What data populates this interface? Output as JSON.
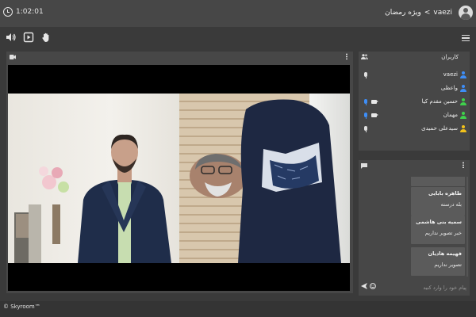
{
  "header": {
    "timer": "1:02:01",
    "breadcrumb_user": "vaezi",
    "breadcrumb_separator": "<",
    "breadcrumb_room": "ویژه رمضان"
  },
  "users_panel": {
    "title": "کاربران",
    "users": [
      {
        "name": "vaezi",
        "icon_color": "#3e8ef7",
        "mic": true,
        "camera": false
      },
      {
        "name": "واعظی",
        "icon_color": "#3e8ef7",
        "mic": false,
        "camera": false
      },
      {
        "name": "حسین مقدم کیا",
        "icon_color": "#3fd14c",
        "mic": true,
        "camera": true
      },
      {
        "name": "مهمان",
        "icon_color": "#3fd14c",
        "mic": true,
        "camera": true
      },
      {
        "name": "سیدعلی حمیدی",
        "icon_color": "#f2c21b",
        "mic": true,
        "camera": false
      }
    ]
  },
  "chat_panel": {
    "messages": [
      {
        "sender": "",
        "text": ""
      },
      {
        "sender": "طاهره بابایی",
        "text": "بله درسته"
      },
      {
        "sender": "سمیه بنی هاشمی",
        "text": "خبر تصویر نداریم"
      },
      {
        "sender": "فهیمه هادیان",
        "text": "تصویر نداریم"
      }
    ],
    "input_placeholder": "پیام خود را وارد کنید"
  },
  "footer": {
    "brand": "© Skyroom™"
  },
  "colors": {
    "background": "#3a3a3a",
    "panel": "#474747",
    "message_bubble": "#5b5b5b",
    "mic_active": "#3e8ef7",
    "mic_inactive": "#e0e0e0"
  }
}
